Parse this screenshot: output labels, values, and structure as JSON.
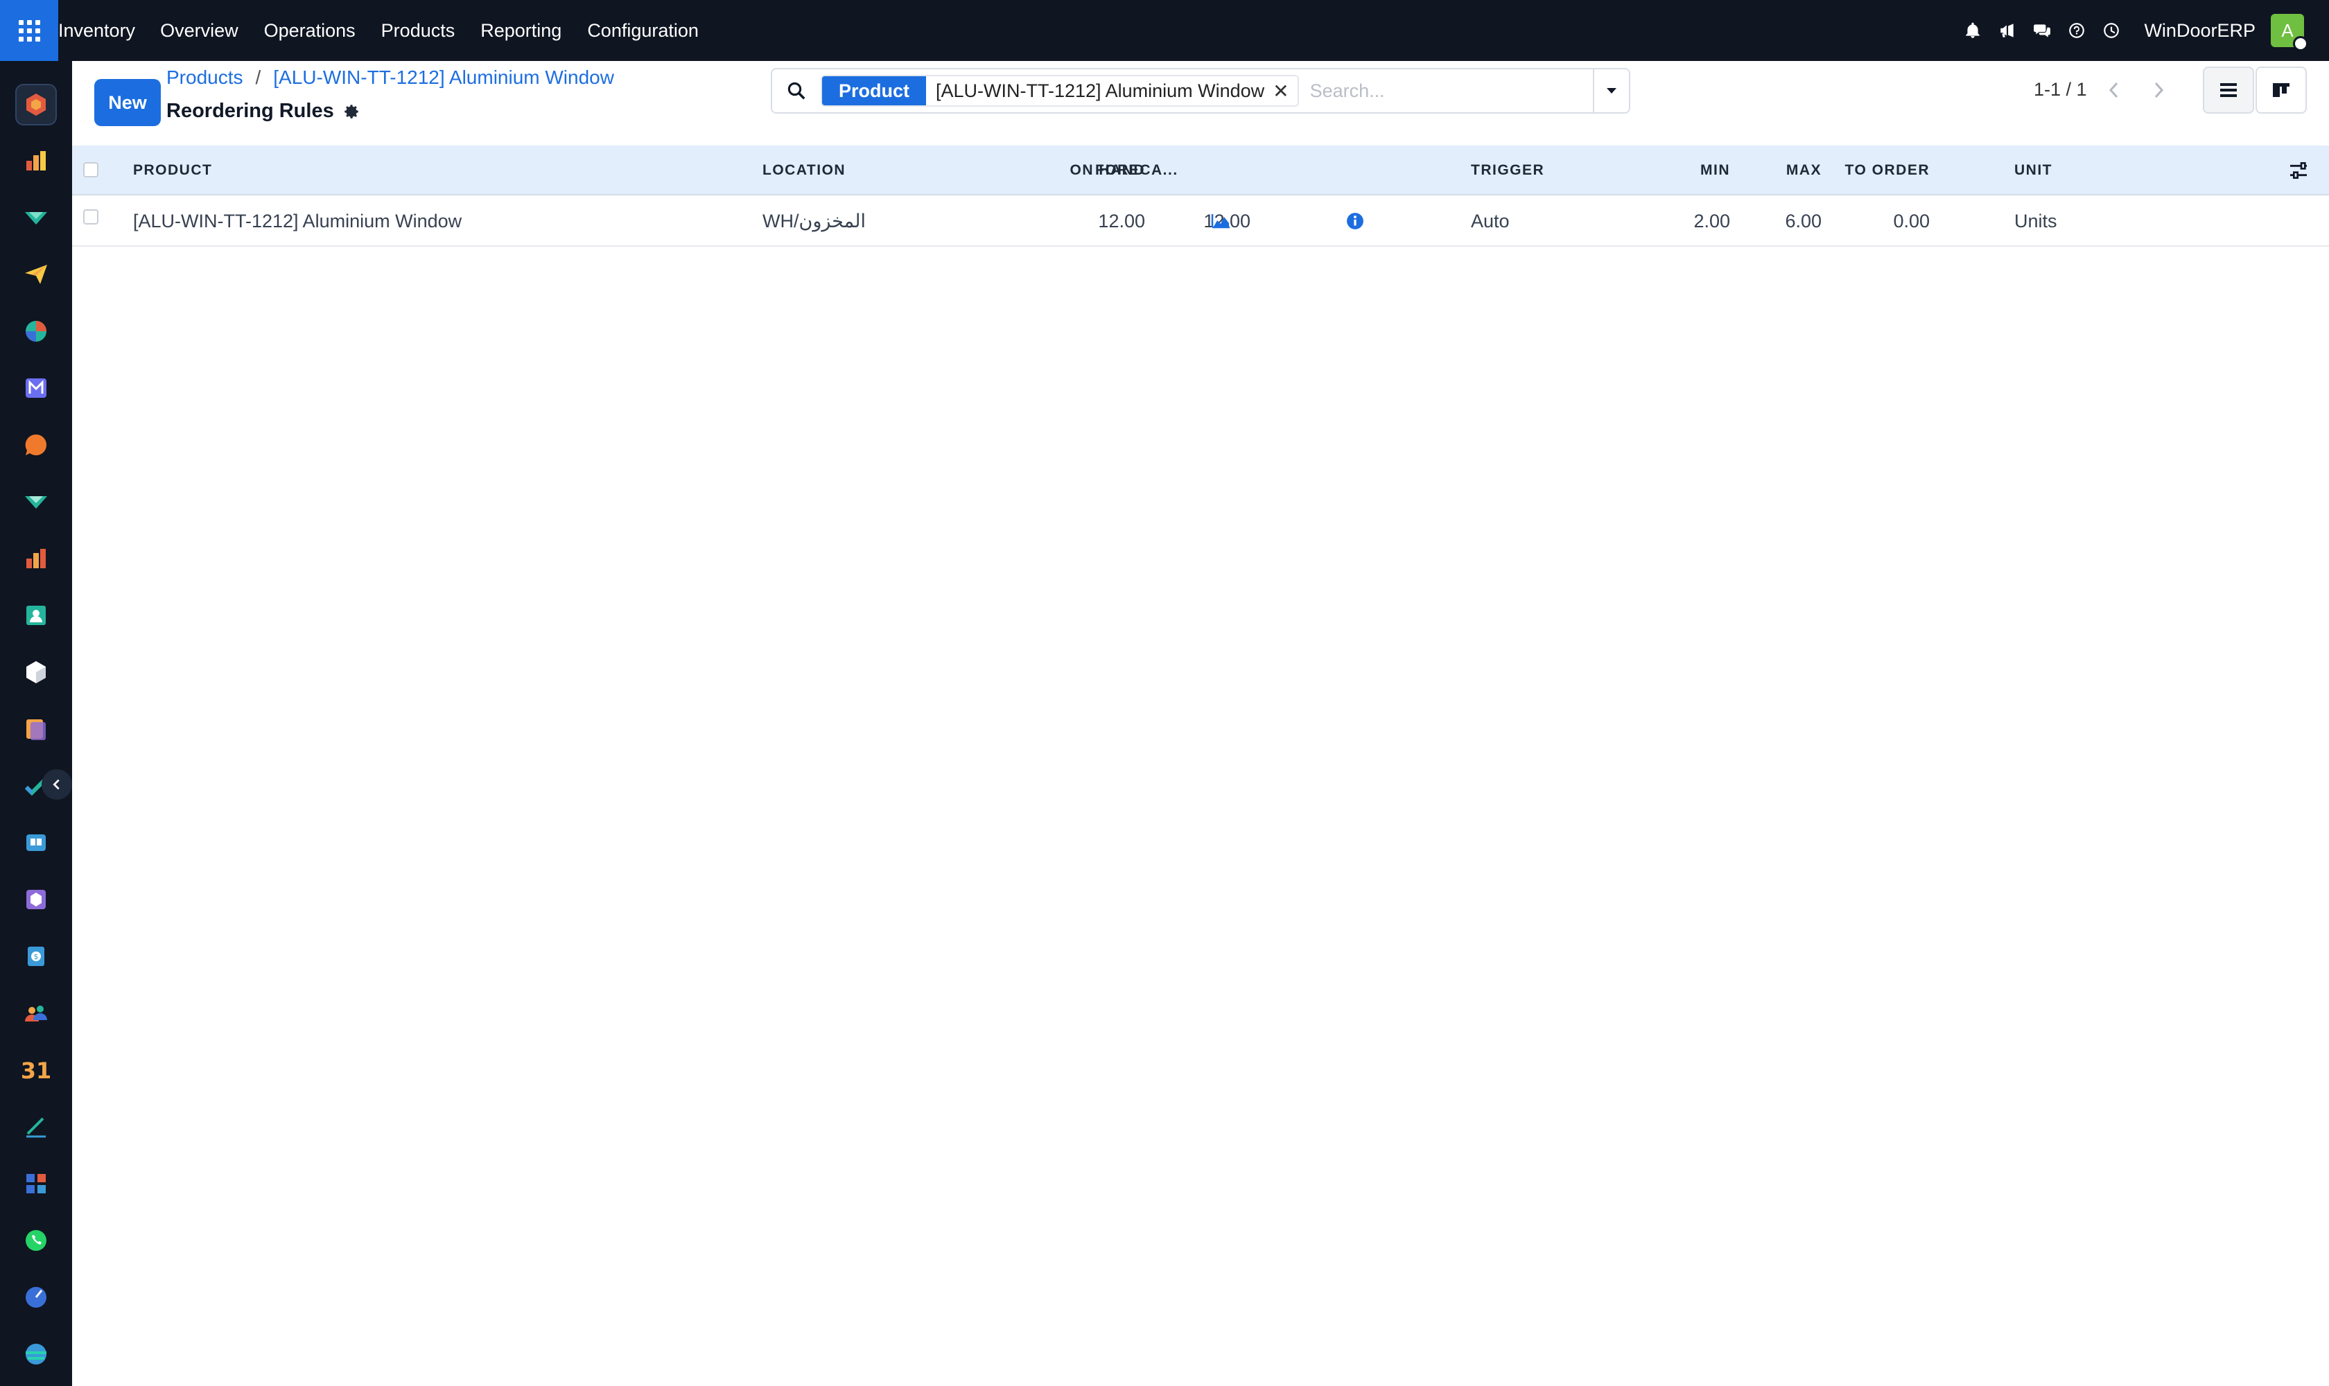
{
  "navbar": {
    "app_name": "Inventory",
    "menu": [
      "Overview",
      "Operations",
      "Products",
      "Reporting",
      "Configuration"
    ],
    "company": "WinDoorERP",
    "avatar_initial": "A",
    "icons": [
      "bell-icon",
      "megaphone-icon",
      "chat-icon",
      "help-icon",
      "clock-icon"
    ]
  },
  "sidebar": {
    "apps": [
      "inventory",
      "sales",
      "crm",
      "discuss",
      "accounting",
      "email-marketing",
      "live-chat",
      "purchase",
      "dashboards",
      "employees",
      "product",
      "documents",
      "project",
      "knowledge",
      "barcode",
      "invoicing",
      "team",
      "calendar",
      "sign",
      "spreadsheet",
      "whatsapp",
      "field-service",
      "website"
    ]
  },
  "control_panel": {
    "new_label": "New",
    "breadcrumb": [
      "Products",
      "[ALU-WIN-TT-1212] Aluminium Window"
    ],
    "breadcrumb_sep": "/",
    "title": "Reordering Rules",
    "search": {
      "facet_label": "Product",
      "facet_value": "[ALU-WIN-TT-1212] Aluminium Window",
      "facet_remove": "✕",
      "placeholder": "Search..."
    },
    "pager": "1-1 / 1"
  },
  "table": {
    "columns": {
      "product": "PRODUCT",
      "location": "LOCATION",
      "on_hand": "ON HAND",
      "forecast": "FORECA...",
      "trigger": "TRIGGER",
      "min": "MIN",
      "max": "MAX",
      "to_order": "TO ORDER",
      "unit": "UNIT"
    },
    "rows": [
      {
        "product": "[ALU-WIN-TT-1212] Aluminium Window",
        "location": "WH/المخزون",
        "on_hand": "12.00",
        "forecast": "12.00",
        "trigger": "Auto",
        "min": "2.00",
        "max": "6.00",
        "to_order": "0.00",
        "unit": "Units"
      }
    ]
  },
  "colors": {
    "navbar_bg": "#0f1521",
    "primary": "#1c6ee0",
    "header_row_bg": "#e3eefc",
    "avatar": "#6fbf40"
  }
}
